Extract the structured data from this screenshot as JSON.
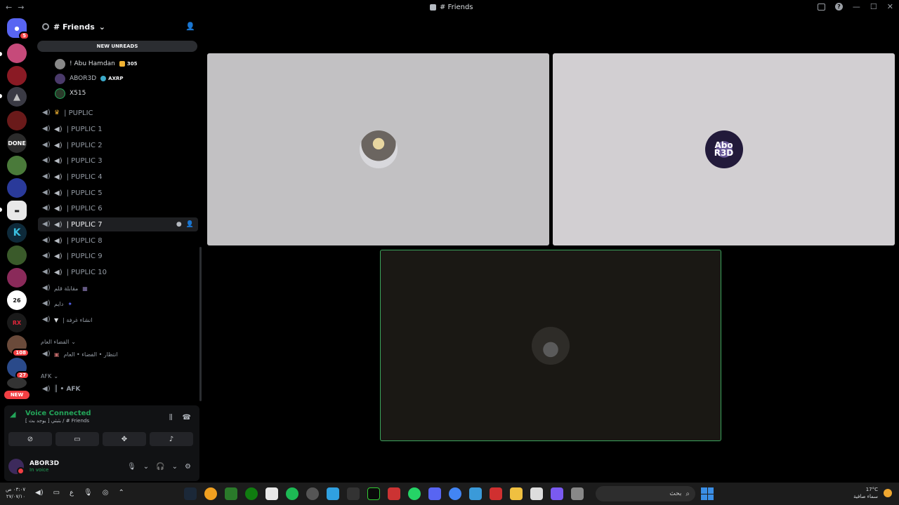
{
  "window": {
    "title": "# Friends",
    "nav_back": "←",
    "nav_forward": "→",
    "minimize": "—",
    "maximize": "☐",
    "close": "✕",
    "help": "?"
  },
  "guilds": {
    "home_badge": "5",
    "badge_108": "108",
    "badge_27": "27",
    "new_label": "NEW",
    "items": [
      {
        "name": "DONE",
        "color": "#2b2b2b"
      },
      {
        "name": "26",
        "color": "#ffffff"
      },
      {
        "name": "RX",
        "color": "#1a1a1a"
      }
    ]
  },
  "sidebar": {
    "server_name": "# Friends",
    "new_unreads": "NEW UNREADS",
    "voice_users": [
      {
        "name": "! Abu Hamdan",
        "tag": "305"
      },
      {
        "name": "ABOR3D",
        "tag": "AXRP"
      },
      {
        "name": "X515",
        "tag": ""
      }
    ],
    "channels": [
      {
        "label": "| PUPLIC"
      },
      {
        "label": "| PUPLIC 1"
      },
      {
        "label": "| PUPLIC 2"
      },
      {
        "label": "| PUPLIC 3"
      },
      {
        "label": "| PUPLIC 4"
      },
      {
        "label": "| PUPLIC 5"
      },
      {
        "label": "| PUPLIC 6"
      },
      {
        "label": "| PUPLIC 7"
      },
      {
        "label": "| PUPLIC 8"
      },
      {
        "label": "| PUPLIC 9"
      },
      {
        "label": "| PUPLIC 10"
      },
      {
        "label": "مقابلة قلم"
      },
      {
        "label": "دايم"
      },
      {
        "label": "| انشاء غرفة"
      }
    ],
    "category_public": "الفضاء العام",
    "channel_public": "انتظار • الفضاء • العام",
    "category_afk": "AFK",
    "channel_afk": "║ • AFK"
  },
  "voice_panel": {
    "status": "Voice Connected",
    "location": "[ يوجد بث ] بثبثي / # Friends"
  },
  "user": {
    "name": "ABOR3D",
    "status": "In voice"
  },
  "stage": {
    "tile2_avatar_text": "Abo R3D"
  },
  "taskbar": {
    "time": "٠٣:٠٧ ص",
    "date": "٢٧/٠٧/١٠",
    "lang": "ع",
    "search_placeholder": "بحث",
    "temperature": "17°C",
    "weather": "سماء صافية"
  },
  "colors": {
    "accent_green": "#23a559",
    "danger_red": "#f23f43",
    "tile_border": "#3ba55c"
  }
}
